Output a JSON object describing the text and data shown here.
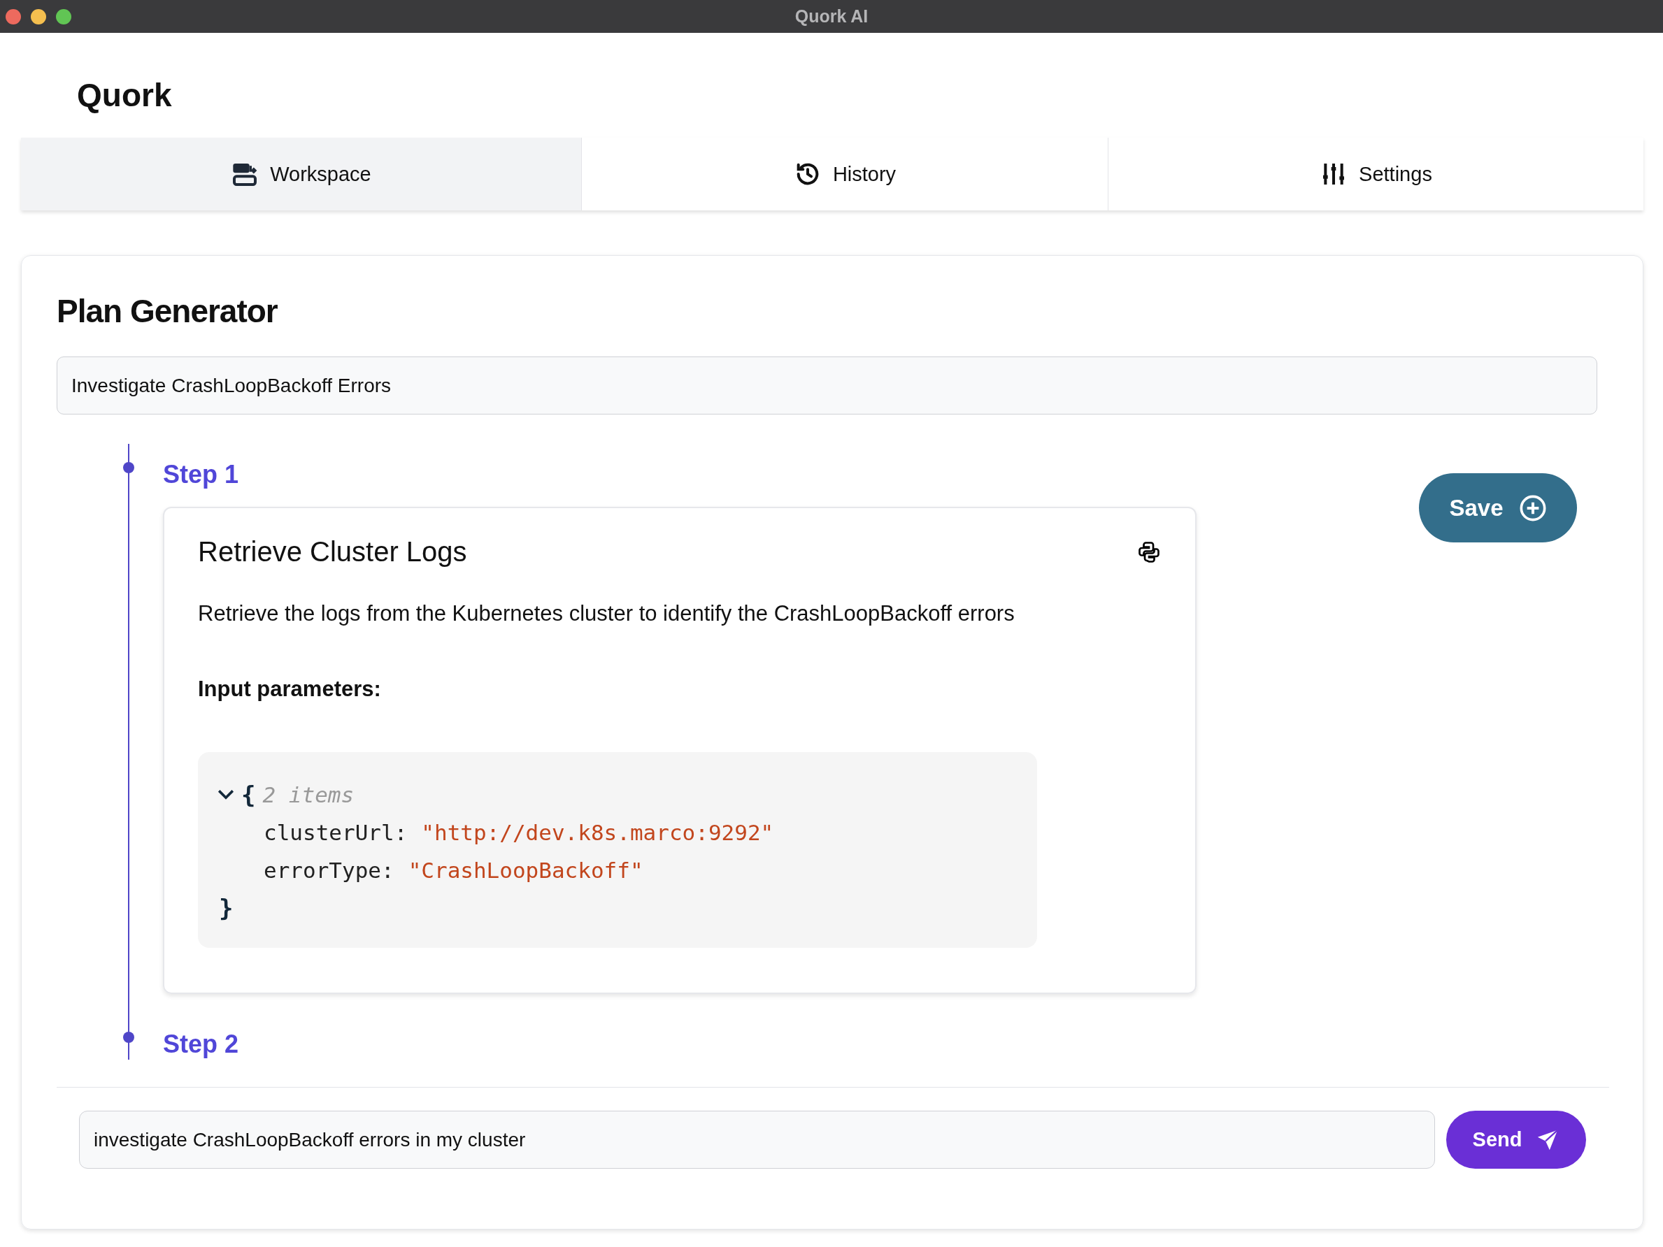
{
  "window": {
    "title": "Quork AI"
  },
  "app": {
    "title": "Quork"
  },
  "tabs": [
    {
      "label": "Workspace",
      "kind": "workspace",
      "selected": true
    },
    {
      "label": "History",
      "kind": "history",
      "selected": false
    },
    {
      "label": "Settings",
      "kind": "settings",
      "selected": false
    }
  ],
  "panel": {
    "title": "Plan Generator",
    "goal_field": {
      "value": "Investigate CrashLoopBackoff Errors"
    },
    "save_button": "Save",
    "steps": [
      {
        "label": "Step 1",
        "title": "Retrieve Cluster Logs",
        "description": "Retrieve the logs from the Kubernetes cluster to identify the CrashLoopBackoff errors",
        "params_heading": "Input parameters:",
        "params": {
          "expanded": true,
          "open_brace": "{",
          "count": "2 items",
          "close_brace": "}",
          "entries": [
            {
              "key": "clusterUrl:",
              "value": "\"http://dev.k8s.marco:9292\""
            },
            {
              "key": "errorType:",
              "value": "\"CrashLoopBackoff\""
            }
          ]
        }
      },
      {
        "label": "Step 2"
      }
    ]
  },
  "composer": {
    "input": {
      "value": "investigate CrashLoopBackoff errors in my cluster"
    },
    "send_button": "Send"
  }
}
